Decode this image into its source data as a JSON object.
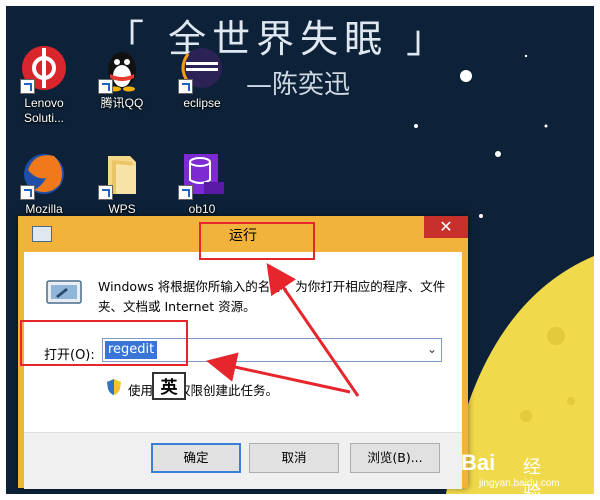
{
  "wallpaper": {
    "title_text": "「 全世界失眠 」",
    "author_text": "—陈奕迅",
    "colors": {
      "sky": "#0b1f33",
      "moon": "#f0d94a"
    }
  },
  "desktop_icons": [
    {
      "label": "Lenovo Soluti...",
      "icon": "lenovo-solutions-icon"
    },
    {
      "label": "腾讯QQ",
      "icon": "qq-penguin-icon"
    },
    {
      "label": "eclipse",
      "icon": "eclipse-icon"
    },
    {
      "label": "Mozilla",
      "icon": "firefox-icon"
    },
    {
      "label": "WPS",
      "icon": "folder-icon"
    },
    {
      "label": "ob10",
      "icon": "database-icon"
    }
  ],
  "dialog": {
    "title": "运行",
    "close_glyph": "✕",
    "description": "Windows 将根据你所输入的名称，为你打开相应的程序、文件夹、文档或 Internet 资源。",
    "open_label": "打开(O):",
    "open_value": "regedit",
    "admin_text": "使用管理权限创建此任务。",
    "ime_indicator": "英",
    "ok_label": "确定",
    "cancel_label": "取消",
    "browse_label": "浏览(B)...",
    "accent_color": "#f2b33d"
  },
  "watermark": {
    "brand": "Bai",
    "jingyan": "经验",
    "url": "jingyan.baidu.com"
  }
}
